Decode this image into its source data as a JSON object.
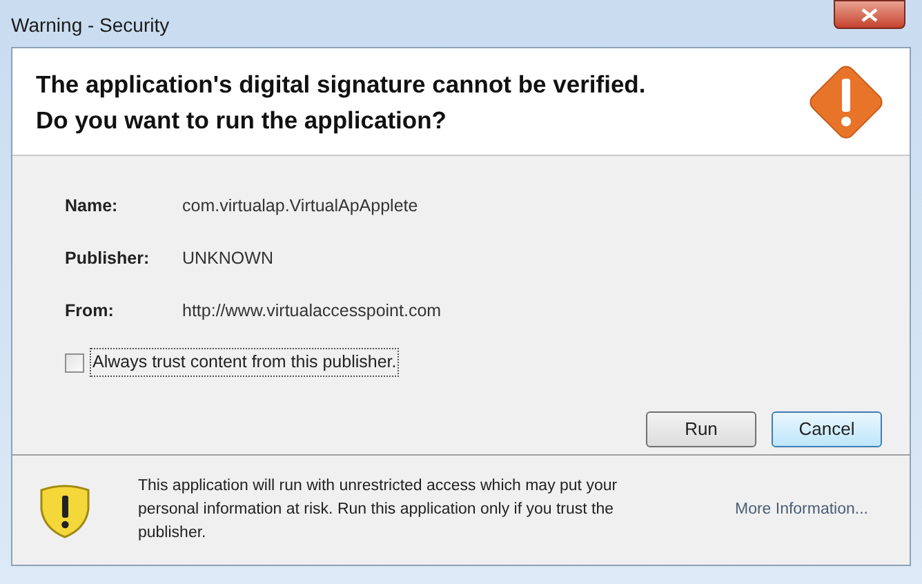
{
  "window": {
    "title": "Warning - Security"
  },
  "header": {
    "lines": [
      "The application's digital signature cannot be verified.",
      "Do you want to run the application?"
    ]
  },
  "details": [
    {
      "label": "Name:",
      "value": "com.virtualap.VirtualApApplete"
    },
    {
      "label": "Publisher:",
      "value": "UNKNOWN"
    },
    {
      "label": "From:",
      "value": "http://www.virtualaccesspoint.com"
    }
  ],
  "trust_checkbox": {
    "label": "Always trust content from this publisher.",
    "checked": false
  },
  "buttons": [
    {
      "label": "Run",
      "selected": false
    },
    {
      "label": "Cancel",
      "selected": true
    }
  ],
  "footer": {
    "message": "This application will run with unrestricted access which may put your personal information at risk. Run this application only if you trust the publisher.",
    "link": "More Information..."
  }
}
